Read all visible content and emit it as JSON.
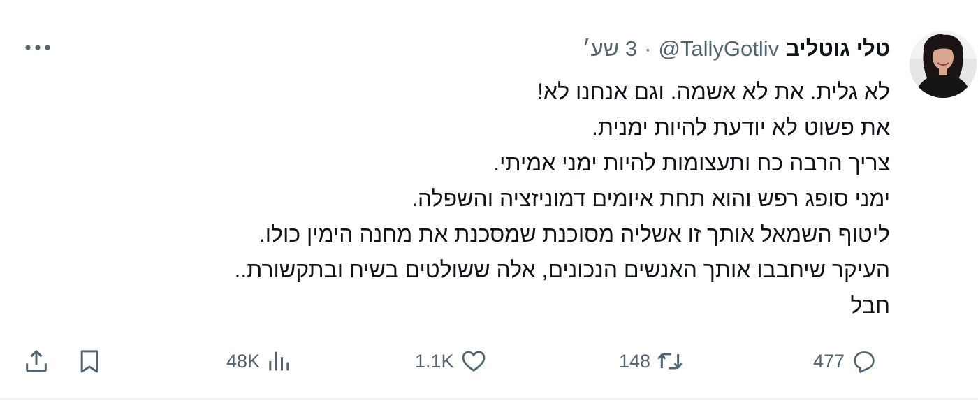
{
  "tweet": {
    "author": {
      "display_name": "טלי גוטליב",
      "handle": "@TallyGotliv",
      "avatar": "profile-photo"
    },
    "separator": "·",
    "time": "3 שע׳",
    "lines": [
      "לא גלית. את לא אשמה. וגם אנחנו לא!",
      "את פשוט לא יודעת להיות ימנית.",
      "צריך הרבה כח ותעצומות להיות ימני אמיתי.",
      "ימני סופג רפש והוא תחת איומים דמוניזציה והשפלה.",
      "ליטוף השמאל אותך זו אשליה מסוכנת שמסכנת את מחנה הימין כולו.",
      "העיקר שיחבבו אותך האנשים הנכונים, אלה ששולטים בשיח ובתקשורת..",
      "חבל"
    ],
    "actions": {
      "reply": {
        "count": "477",
        "icon": "reply-icon"
      },
      "retweet": {
        "count": "148",
        "icon": "retweet-icon"
      },
      "like": {
        "count": "1.1K",
        "icon": "heart-icon"
      },
      "views": {
        "count": "48K",
        "icon": "analytics-icon"
      },
      "bookmark": {
        "icon": "bookmark-icon"
      },
      "share": {
        "icon": "share-icon"
      }
    },
    "more_icon": "more-horizontal-icon"
  },
  "colors": {
    "text_primary": "#0f1419",
    "text_secondary": "#536471",
    "border": "#eff3f4",
    "background": "#ffffff"
  }
}
